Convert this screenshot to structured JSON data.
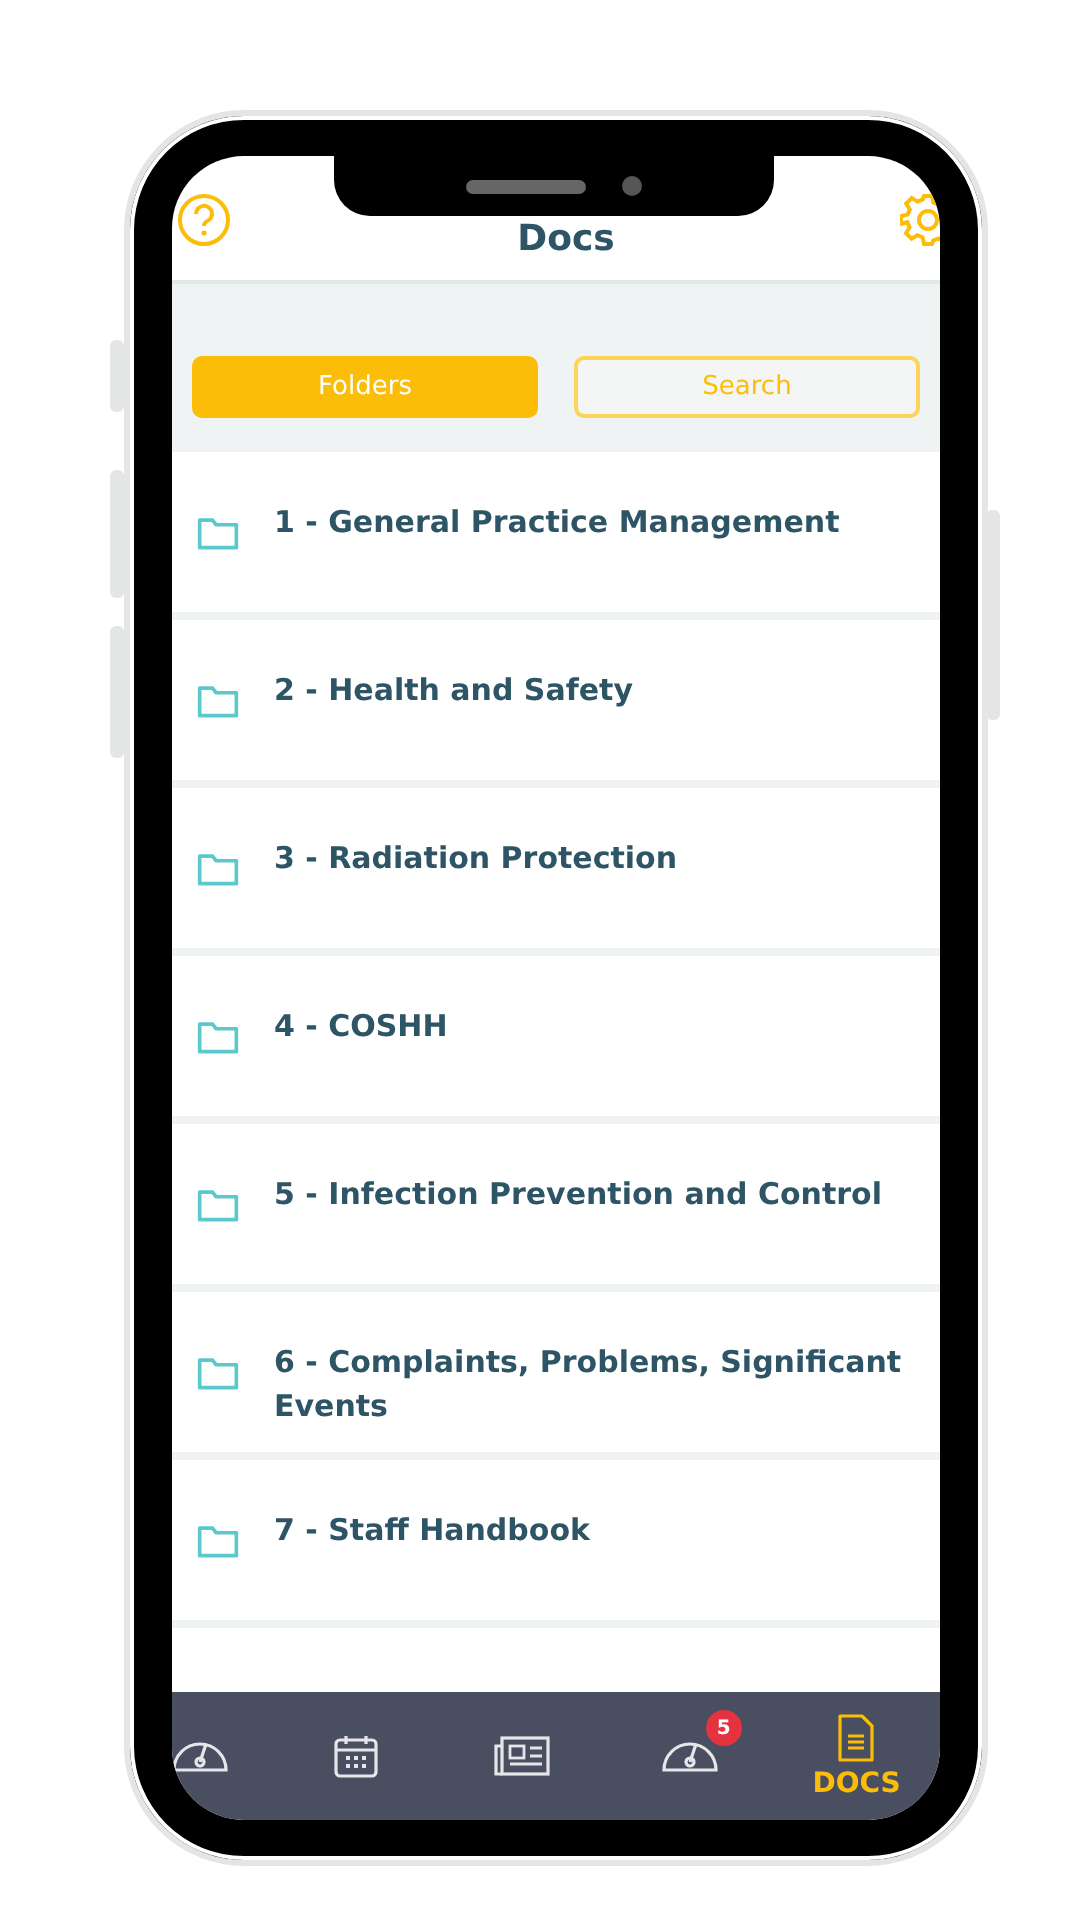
{
  "header": {
    "title": "Docs"
  },
  "tabs": [
    {
      "label": "Folders",
      "selected": true
    },
    {
      "label": "Search",
      "selected": false
    }
  ],
  "folders": [
    {
      "name": "1 - General Practice Management"
    },
    {
      "name": "2 - Health and Safety"
    },
    {
      "name": "3 - Radiation Protection"
    },
    {
      "name": "4 - COSHH"
    },
    {
      "name": "5 - Infection Prevention and Control"
    },
    {
      "name": "6 - Complaints, Problems, Significant Events"
    },
    {
      "name": "7 - Staff Handbook"
    }
  ],
  "nav": [
    {
      "kind": "gauge",
      "selected": false
    },
    {
      "kind": "calendar",
      "selected": false
    },
    {
      "kind": "news",
      "selected": false
    },
    {
      "kind": "gauge",
      "selected": false,
      "badge": "5"
    },
    {
      "kind": "docs",
      "selected": true,
      "label": "DOCS"
    }
  ]
}
